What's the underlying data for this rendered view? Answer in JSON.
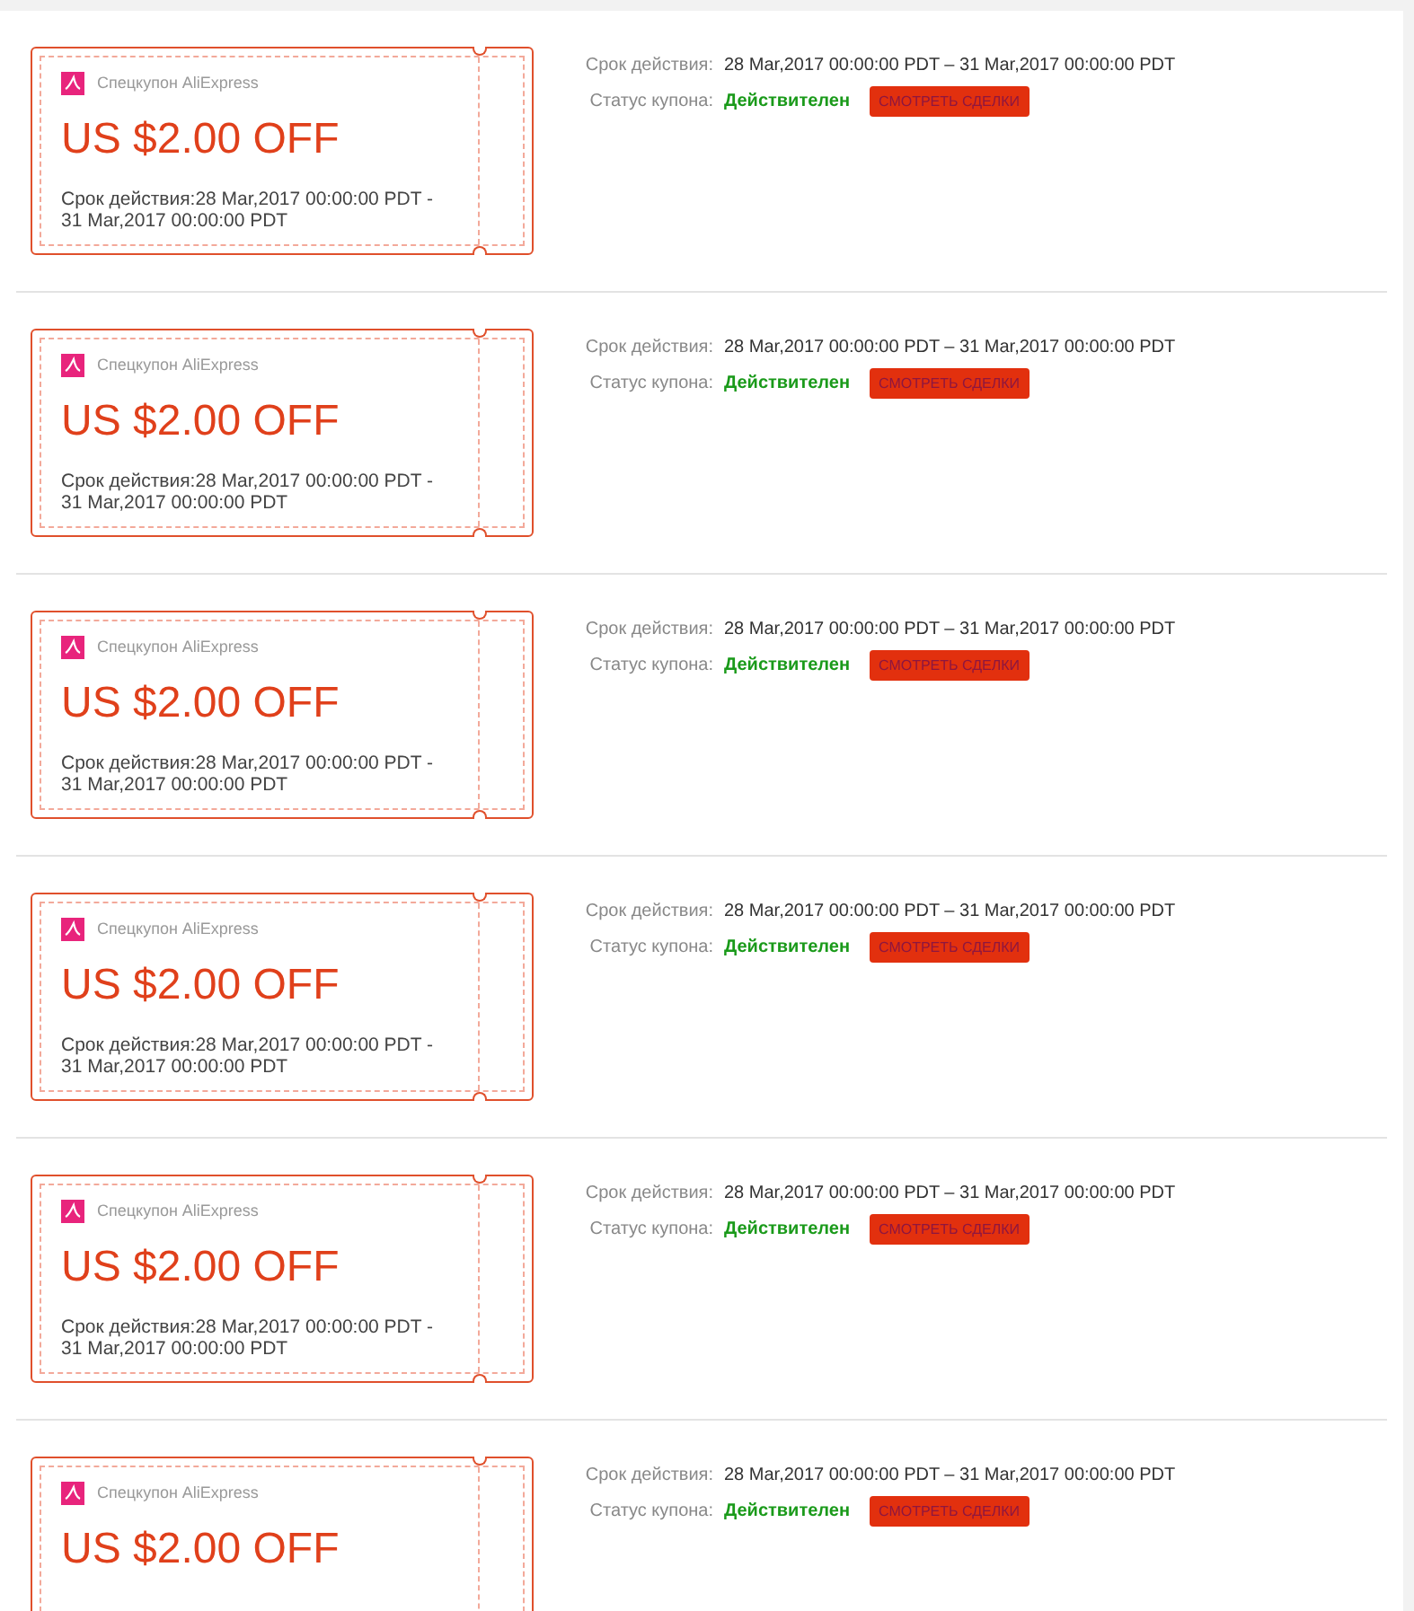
{
  "coupons": [
    {
      "brand": "Спецкупон AliExpress",
      "amount": "US $2.00 OFF",
      "validity": "Срок действия:28 Mar,2017 00:00:00 PDT - 31 Mar,2017 00:00:00 PDT",
      "period_label": "Срок действия:",
      "period": "28 Mar,2017 00:00:00 PDT – 31 Mar,2017 00:00:00 PDT",
      "status_label": "Статус купона:",
      "status": "Действителен",
      "button": "СМОТРЕТЬ СДЕЛКИ"
    },
    {
      "brand": "Спецкупон AliExpress",
      "amount": "US $2.00 OFF",
      "validity": "Срок действия:28 Mar,2017 00:00:00 PDT - 31 Mar,2017 00:00:00 PDT",
      "period_label": "Срок действия:",
      "period": "28 Mar,2017 00:00:00 PDT – 31 Mar,2017 00:00:00 PDT",
      "status_label": "Статус купона:",
      "status": "Действителен",
      "button": "СМОТРЕТЬ СДЕЛКИ"
    },
    {
      "brand": "Спецкупон AliExpress",
      "amount": "US $2.00 OFF",
      "validity": "Срок действия:28 Mar,2017 00:00:00 PDT - 31 Mar,2017 00:00:00 PDT",
      "period_label": "Срок действия:",
      "period": "28 Mar,2017 00:00:00 PDT – 31 Mar,2017 00:00:00 PDT",
      "status_label": "Статус купона:",
      "status": "Действителен",
      "button": "СМОТРЕТЬ СДЕЛКИ"
    },
    {
      "brand": "Спецкупон AliExpress",
      "amount": "US $2.00 OFF",
      "validity": "Срок действия:28 Mar,2017 00:00:00 PDT - 31 Mar,2017 00:00:00 PDT",
      "period_label": "Срок действия:",
      "period": "28 Mar,2017 00:00:00 PDT – 31 Mar,2017 00:00:00 PDT",
      "status_label": "Статус купона:",
      "status": "Действителен",
      "button": "СМОТРЕТЬ СДЕЛКИ"
    },
    {
      "brand": "Спецкупон AliExpress",
      "amount": "US $2.00 OFF",
      "validity": "Срок действия:28 Mar,2017 00:00:00 PDT - 31 Mar,2017 00:00:00 PDT",
      "period_label": "Срок действия:",
      "period": "28 Mar,2017 00:00:00 PDT – 31 Mar,2017 00:00:00 PDT",
      "status_label": "Статус купона:",
      "status": "Действителен",
      "button": "СМОТРЕТЬ СДЕЛКИ"
    },
    {
      "brand": "Спецкупон AliExpress",
      "amount": "US $2.00 OFF",
      "period_label": "Срок действия:",
      "period": "28 Mar,2017 00:00:00 PDT – 31 Mar,2017 00:00:00 PDT",
      "status_label": "Статус купона:",
      "status": "Действителен",
      "button": "СМОТРЕТЬ СДЕЛКИ"
    }
  ]
}
